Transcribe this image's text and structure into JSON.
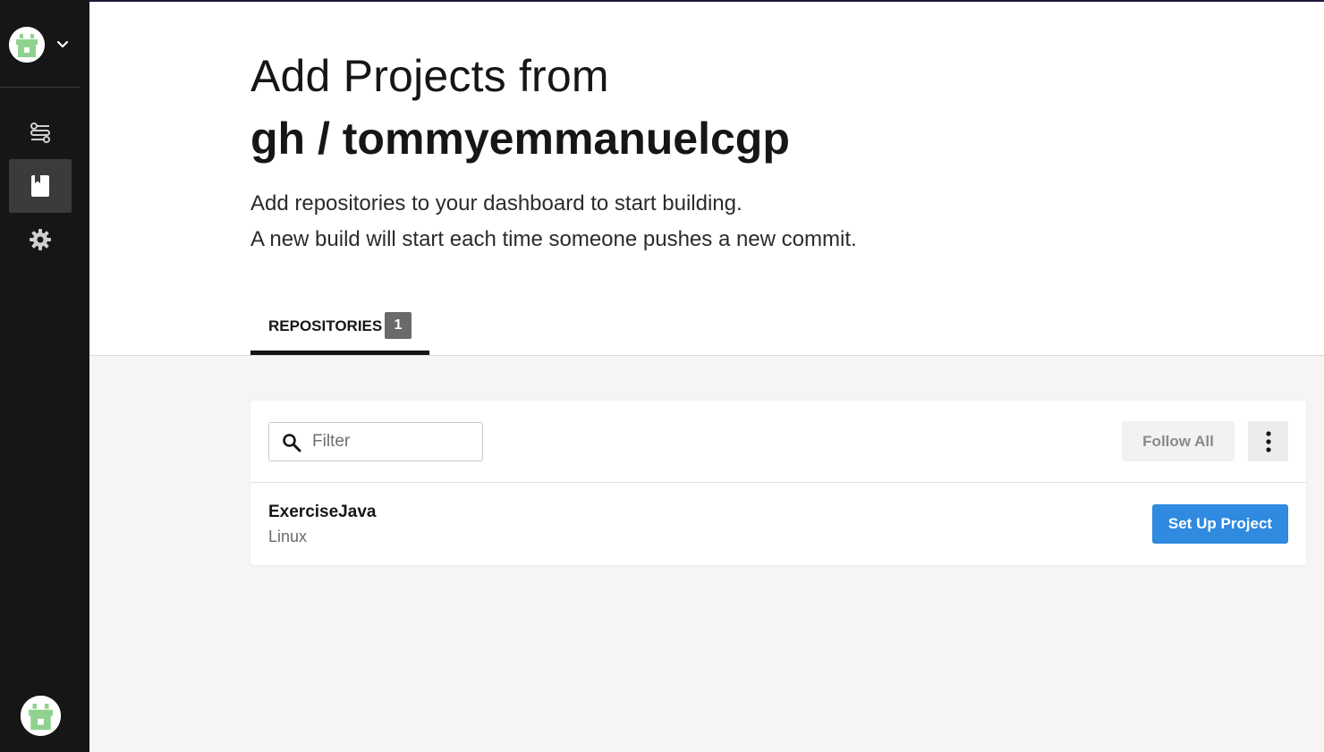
{
  "header": {
    "title_prefix": "Add Projects from",
    "title_org": "gh / tommyemmanuelcgp",
    "description_line1": "Add repositories to your dashboard to start building.",
    "description_line2": "A new build will start each time someone pushes a new commit."
  },
  "tabs": [
    {
      "label": "REPOSITORIES",
      "count": "1",
      "active": true
    }
  ],
  "toolbar": {
    "filter_placeholder": "Filter",
    "follow_all_label": "Follow All"
  },
  "repositories": [
    {
      "name": "ExerciseJava",
      "os": "Linux",
      "action_label": "Set Up Project"
    }
  ],
  "sidebar": {
    "items": [
      {
        "icon": "pipelines-icon",
        "active": false
      },
      {
        "icon": "add-projects-icon",
        "active": true
      },
      {
        "icon": "gear-icon",
        "active": false
      }
    ]
  },
  "colors": {
    "sidebar_bg": "#161616",
    "primary_button": "#2f8ae0",
    "avatar_green": "#8fd28f"
  }
}
